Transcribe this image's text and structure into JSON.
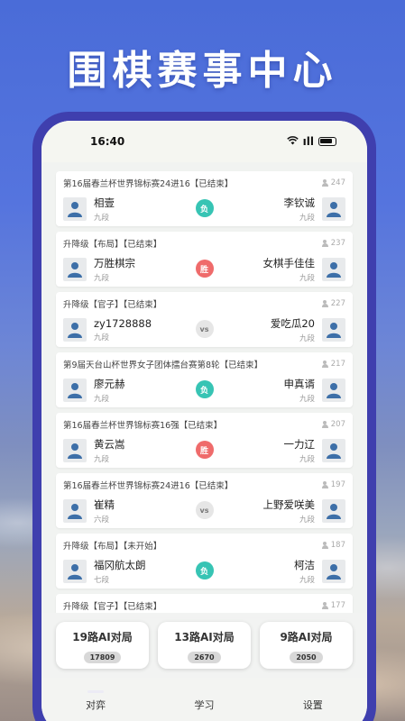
{
  "headline": "围棋赛事中心",
  "status": {
    "time": "16:40",
    "signal": "ᯤ",
    "network": "ıll"
  },
  "matches": [
    {
      "title": "第16届春兰杯世界锦标赛24进16【已结束】",
      "count": "247",
      "left_name": "相壹",
      "left_rank": "九段",
      "result": "负",
      "result_type": "lose",
      "right_name": "李钦诚",
      "right_rank": "九段"
    },
    {
      "title": "升降级【布局】【已结束】",
      "count": "237",
      "left_name": "万胜棋宗",
      "left_rank": "九段",
      "result": "胜",
      "result_type": "win",
      "right_name": "女棋手佳佳",
      "right_rank": "九段"
    },
    {
      "title": "升降级【官子】【已结束】",
      "count": "227",
      "left_name": "zy1728888",
      "left_rank": "九段",
      "result": "vs",
      "result_type": "vs",
      "right_name": "爱吃瓜20",
      "right_rank": "九段"
    },
    {
      "title": "第9届天台山杯世界女子团体擂台赛第8轮【已结束】",
      "count": "217",
      "left_name": "廖元赫",
      "left_rank": "九段",
      "result": "负",
      "result_type": "lose",
      "right_name": "申真谞",
      "right_rank": "九段"
    },
    {
      "title": "第16届春兰杯世界锦标赛16强【已结束】",
      "count": "207",
      "left_name": "黄云嵩",
      "left_rank": "九段",
      "result": "胜",
      "result_type": "win",
      "right_name": "一力辽",
      "right_rank": "九段"
    },
    {
      "title": "第16届春兰杯世界锦标赛24进16【已结束】",
      "count": "197",
      "left_name": "崔精",
      "left_rank": "六段",
      "result": "vs",
      "result_type": "vs",
      "right_name": "上野爱咲美",
      "right_rank": "九段"
    },
    {
      "title": "升降级【布局】【未开始】",
      "count": "187",
      "left_name": "福冈航太朗",
      "left_rank": "七段",
      "result": "负",
      "result_type": "lose",
      "right_name": "柯洁",
      "right_rank": "九段"
    },
    {
      "title": "升降级【官子】【已结束】",
      "count": "177"
    }
  ],
  "ai_buttons": [
    {
      "label": "19路AI对局",
      "count": "17809"
    },
    {
      "label": "13路AI对局",
      "count": "2670"
    },
    {
      "label": "9路AI对局",
      "count": "2050"
    }
  ],
  "nav": [
    {
      "label": "对弈",
      "active": true
    },
    {
      "label": "学习",
      "active": false
    },
    {
      "label": "设置",
      "active": false
    }
  ],
  "colors": {
    "lose": "#37c4b4",
    "win": "#ef6b6b",
    "frame": "#3f3fae",
    "avatar": "#3d6fa8"
  }
}
